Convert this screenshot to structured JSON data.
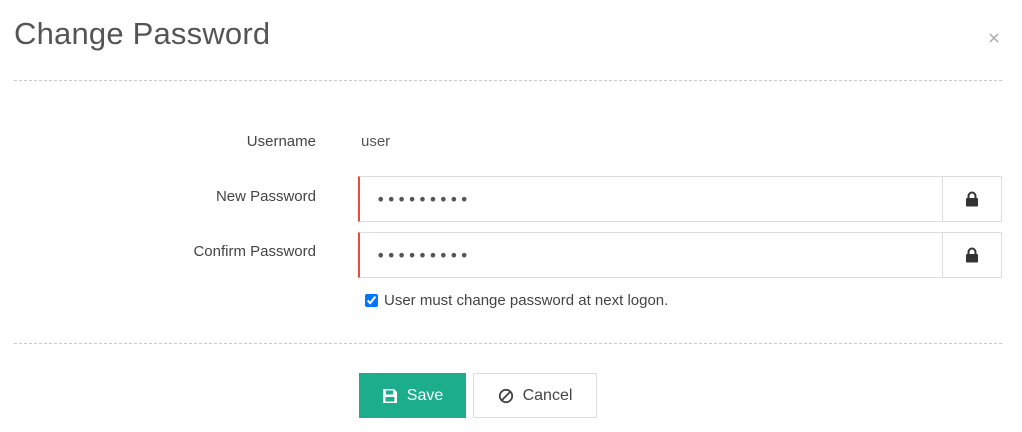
{
  "dialog": {
    "title": "Change Password",
    "close_icon": "close-icon"
  },
  "form": {
    "username": {
      "label": "Username",
      "value": "user"
    },
    "new_password": {
      "label": "New Password",
      "value": "•••••••••",
      "addon_icon": "lock-icon"
    },
    "confirm_password": {
      "label": "Confirm Password",
      "value": "•••••••••",
      "addon_icon": "lock-icon"
    },
    "must_change": {
      "label": "User must change password at next logon.",
      "checked": true
    }
  },
  "buttons": {
    "save_label": "Save",
    "save_icon": "floppy-disk-icon",
    "cancel_label": "Cancel",
    "cancel_icon": "ban-icon"
  },
  "colors": {
    "accent": "#1cae8c",
    "error_border": "#e74c3c"
  }
}
